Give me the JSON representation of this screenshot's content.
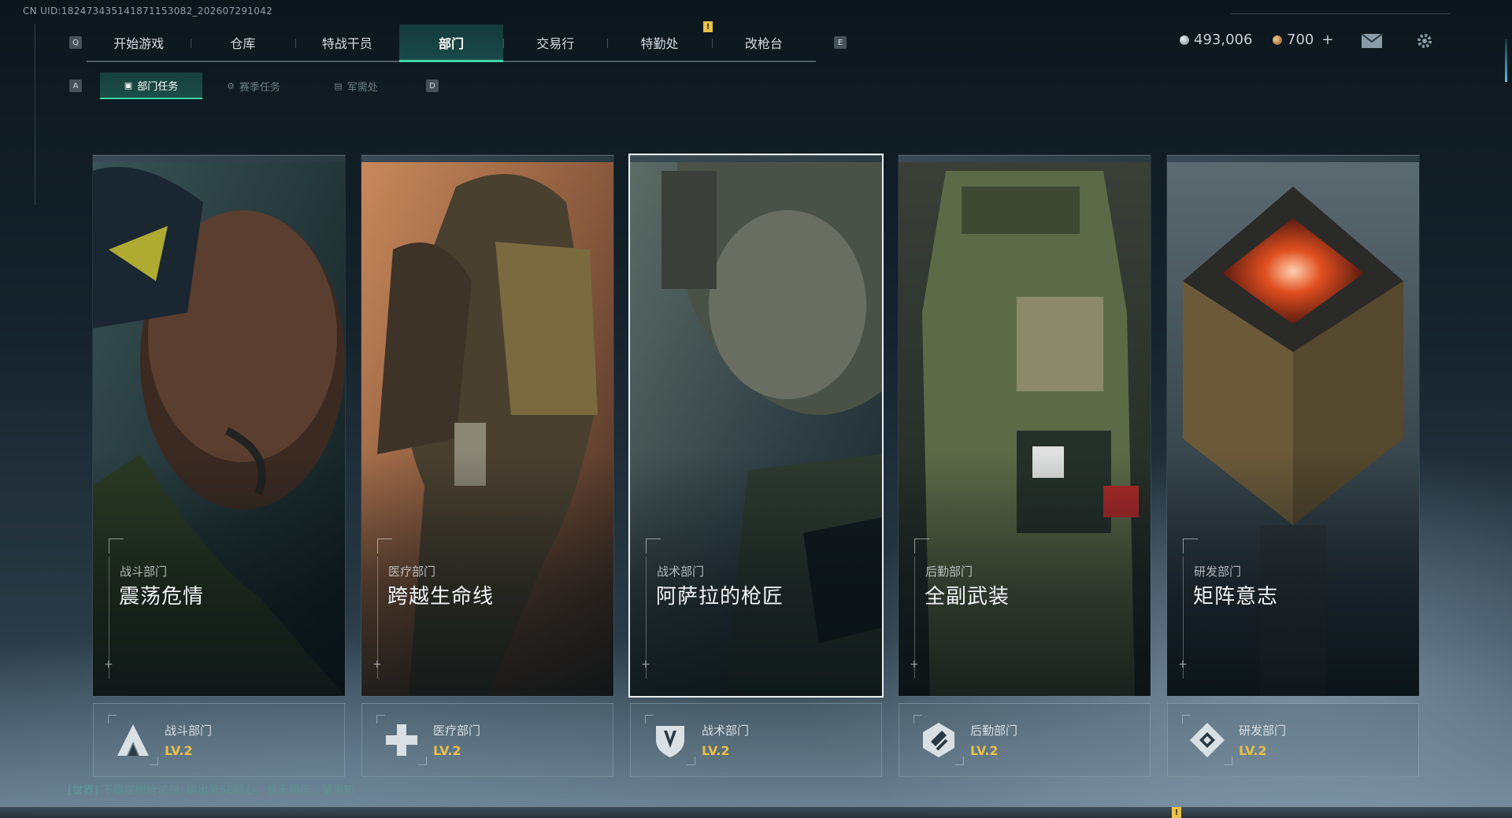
{
  "uid_text": "CN UID:18247343514187115308​2_202607291042",
  "top_nav": {
    "left_key": "Q",
    "right_key": "E",
    "tabs": [
      {
        "label": "开始游戏"
      },
      {
        "label": "仓库"
      },
      {
        "label": "特战干员"
      },
      {
        "label": "部门",
        "active": true
      },
      {
        "label": "交易行"
      },
      {
        "label": "特勤处"
      },
      {
        "label": "改枪台"
      }
    ],
    "notification": "!"
  },
  "sub_nav": {
    "left_key": "A",
    "right_key": "D",
    "tabs": [
      {
        "label": "部门任务",
        "icon": "task-icon",
        "active": true
      },
      {
        "label": "赛季任务",
        "icon": "season-icon"
      },
      {
        "label": "军需处",
        "icon": "supply-icon"
      }
    ]
  },
  "currency": {
    "silver": {
      "value": "493,006",
      "icon": "silver-coin-icon",
      "color": "#b8c2c8"
    },
    "gold": {
      "value": "700",
      "icon": "gold-coin-icon",
      "color": "#d0a060",
      "add": "+"
    }
  },
  "icons": {
    "mail": "mail-icon",
    "settings": "gear-icon"
  },
  "departments": [
    {
      "dept": "战斗部门",
      "title": "震荡危情",
      "level": "LV.2",
      "icon": "combat-dept-icon",
      "selected": false
    },
    {
      "dept": "医疗部门",
      "title": "跨越生命线",
      "level": "LV.2",
      "icon": "medical-dept-icon",
      "selected": false
    },
    {
      "dept": "战术部门",
      "title": "阿萨拉的枪匠",
      "level": "LV.2",
      "icon": "tactical-dept-icon",
      "selected": true
    },
    {
      "dept": "后勤部门",
      "title": "全副武装",
      "level": "LV.2",
      "icon": "logistics-dept-icon",
      "selected": false
    },
    {
      "dept": "研发部门",
      "title": "矩阵意志",
      "level": "LV.2",
      "icon": "research-dept-icon",
      "selected": false
    }
  ],
  "chat": {
    "channel": "[世界]",
    "sender": "不稳定刷枪试剂",
    "message": ": 刷出第58颗心，普天同庆，望周知"
  },
  "colors": {
    "accent": "#3fd4a8",
    "level": "#e8c04a"
  }
}
